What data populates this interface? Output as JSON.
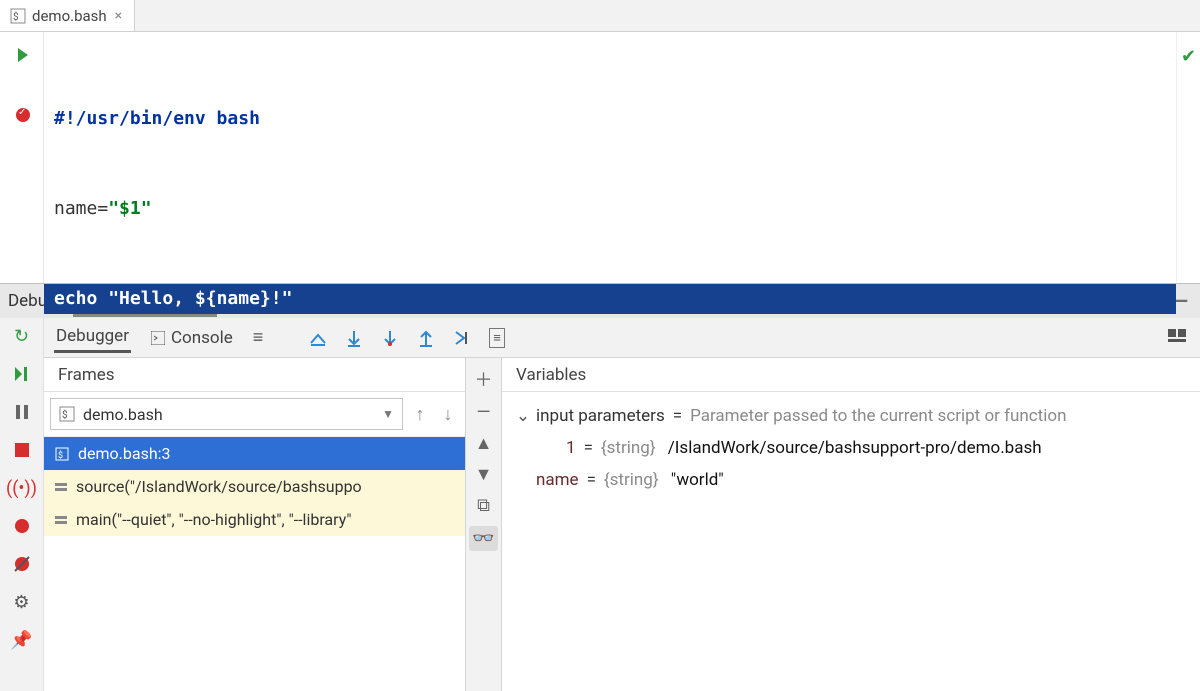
{
  "editor": {
    "tab_file": "demo.bash",
    "code": {
      "line1_shebang": "#!/usr/bin/env bash",
      "line2_lhs": "name=",
      "line2_str": "\"$1\"",
      "line3_kw": "echo",
      "line3_str": "\"Hello, ${name}!\""
    }
  },
  "debug": {
    "label": "Debug:",
    "session_tab": "demo.bash",
    "subtabs": {
      "debugger": "Debugger",
      "console": "Console"
    },
    "frames": {
      "header": "Frames",
      "selector": "demo.bash",
      "stack": [
        {
          "label": "demo.bash:3",
          "selected": true,
          "lib": false
        },
        {
          "label": "source(\"/IslandWork/source/bashsuppo",
          "selected": false,
          "lib": true
        },
        {
          "label": "main(\"--quiet\", \"--no-highlight\", \"--library\"",
          "selected": false,
          "lib": true
        }
      ]
    },
    "vars": {
      "header": "Variables",
      "rows": [
        {
          "name": "input parameters",
          "desc": "Parameter passed to the current script or function",
          "kind": "group"
        },
        {
          "name": "1",
          "type": "{string}",
          "value": "/IslandWork/source/bashsupport-pro/demo.bash",
          "kind": "child"
        },
        {
          "name": "name",
          "type": "{string}",
          "value": "\"world\"",
          "kind": "leaf"
        }
      ]
    }
  }
}
